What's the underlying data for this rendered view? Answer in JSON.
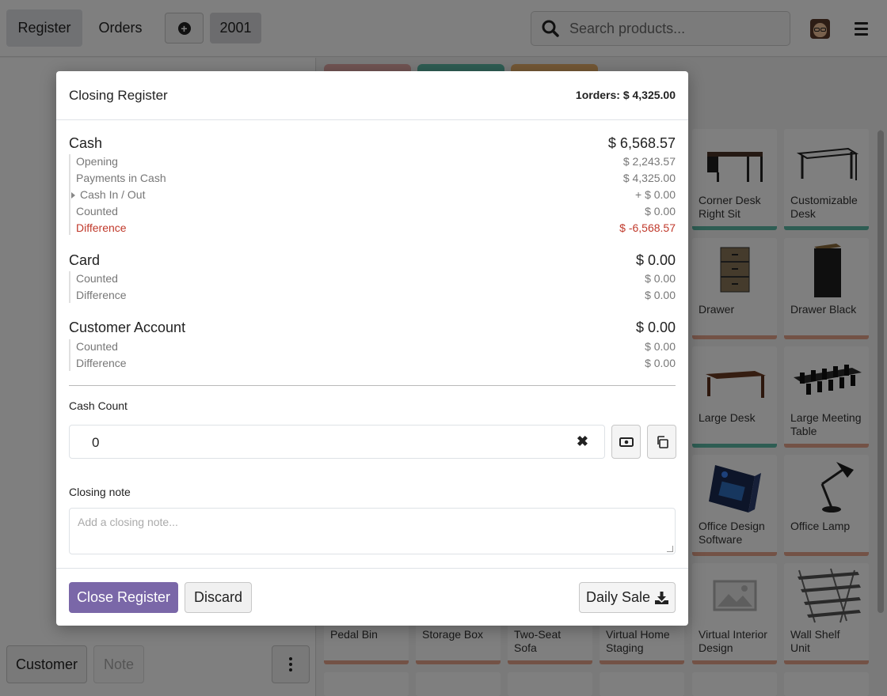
{
  "topbar": {
    "register_tab": "Register",
    "orders_tab": "Orders",
    "order_number": "2001",
    "search_placeholder": "Search products..."
  },
  "left_pane": {
    "customer_button": "Customer",
    "note_button": "Note"
  },
  "products": [
    {
      "name": "Corner Desk Right Sit",
      "bar_color": "#5dbaa6"
    },
    {
      "name": "Customizable Desk",
      "bar_color": "#5dbaa6"
    },
    {
      "name": "Drawer",
      "bar_color": "#e7a48c"
    },
    {
      "name": "Drawer Black",
      "bar_color": "#e7a48c"
    },
    {
      "name": "Large Desk",
      "bar_color": "#5dbaa6"
    },
    {
      "name": "Large Meeting Table",
      "bar_color": "#e7a48c"
    },
    {
      "name": "Office Design Software",
      "bar_color": "#e7a48c"
    },
    {
      "name": "Office Lamp",
      "bar_color": "#e7a48c"
    },
    {
      "name": "Pedal Bin",
      "bar_color": "#e7a48c"
    },
    {
      "name": "Storage Box",
      "bar_color": "#e7a48c"
    },
    {
      "name": "Two-Seat Sofa",
      "bar_color": "#e7a48c"
    },
    {
      "name": "Virtual Home Staging",
      "bar_color": "#e7a48c"
    },
    {
      "name": "Virtual Interior Design",
      "bar_color": "#e7a48c"
    },
    {
      "name": "Wall Shelf Unit",
      "bar_color": "#e7a48c"
    }
  ],
  "category_chip_colors": [
    "#e3a8a6",
    "#5dbaa6",
    "#e8b06b"
  ],
  "modal": {
    "title": "Closing Register",
    "orders_summary": "1orders: $ 4,325.00",
    "cash": {
      "title": "Cash",
      "total": "$ 6,568.57",
      "opening_label": "Opening",
      "opening_value": "$ 2,243.57",
      "payments_label": "Payments in Cash",
      "payments_value": "$ 4,325.00",
      "cash_in_out_label": "Cash In / Out",
      "cash_in_out_value": "+ $ 0.00",
      "counted_label": "Counted",
      "counted_value": "$ 0.00",
      "difference_label": "Difference",
      "difference_value": "$ -6,568.57"
    },
    "card": {
      "title": "Card",
      "total": "$ 0.00",
      "counted_label": "Counted",
      "counted_value": "$ 0.00",
      "difference_label": "Difference",
      "difference_value": "$ 0.00"
    },
    "customer_account": {
      "title": "Customer Account",
      "total": "$ 0.00",
      "counted_label": "Counted",
      "counted_value": "$ 0.00",
      "difference_label": "Difference",
      "difference_value": "$ 0.00"
    },
    "cash_count_label": "Cash Count",
    "cash_count_value": "0",
    "closing_note_label": "Closing note",
    "closing_note_placeholder": "Add a closing note...",
    "close_register_button": "Close Register",
    "discard_button": "Discard",
    "daily_sale_button": "Daily Sale"
  },
  "colors": {
    "primary": "#7a67a8",
    "difference_red": "#c0392b"
  }
}
